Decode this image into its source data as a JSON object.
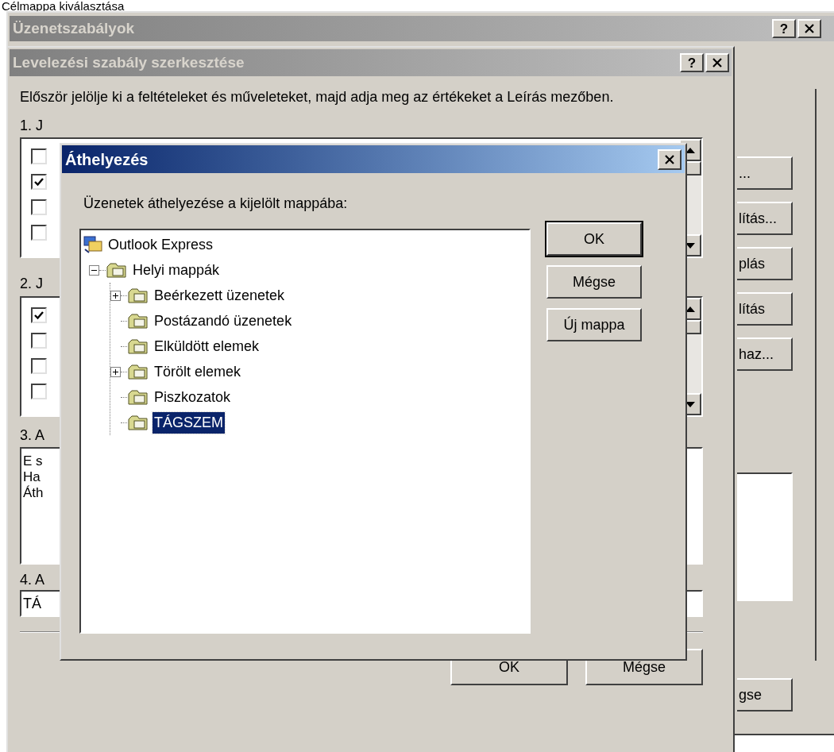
{
  "caption": "Célmappa kiválasztása",
  "rules_window": {
    "title": "Üzenetszabályok",
    "help": "?",
    "side_buttons": [
      "...",
      "lítás...",
      "plás",
      "lítás",
      "haz..."
    ],
    "bottom_button": "gse"
  },
  "editor_window": {
    "title": "Levelezési szabály szerkesztése",
    "help": "?",
    "intro": "Először jelölje ki a feltételeket és műveleteket, majd adja meg az értékeket a Leírás mezőben.",
    "section_1": "1. J",
    "conditions": [
      {
        "checked": false
      },
      {
        "checked": true
      },
      {
        "checked": false
      },
      {
        "checked": false
      }
    ],
    "section_2": "2. J",
    "actions": [
      {
        "checked": true
      },
      {
        "checked": false
      },
      {
        "checked": false
      },
      {
        "checked": false
      }
    ],
    "section_3": "3. A",
    "description_lines": [
      "E s",
      "Ha",
      "Áth"
    ],
    "section_4": "4. A",
    "rule_name_value": "TÁ",
    "buttons": [
      "OK",
      "Mégse"
    ]
  },
  "move_dialog": {
    "title": "Áthelyezés",
    "label": "Üzenetek áthelyezése a kijelölt mappába:",
    "tree": [
      {
        "label": "Outlook Express",
        "selected": false,
        "children": [
          {
            "label": "Helyi mappák",
            "selected": false,
            "expanded": true,
            "children": [
              {
                "label": "Beérkezett üzenetek",
                "selected": false,
                "expanded": false
              },
              {
                "label": "Postázandó üzenetek",
                "selected": false
              },
              {
                "label": "Elküldött elemek",
                "selected": false
              },
              {
                "label": "Törölt elemek",
                "selected": false,
                "expanded": false
              },
              {
                "label": "Piszkozatok",
                "selected": false
              },
              {
                "label": "TÁGSZEM",
                "selected": true
              }
            ]
          }
        ]
      }
    ],
    "buttons": [
      {
        "label": "OK",
        "default": true
      },
      {
        "label": "Mégse",
        "default": false
      },
      {
        "label": "Új mappa",
        "default": false
      }
    ]
  }
}
